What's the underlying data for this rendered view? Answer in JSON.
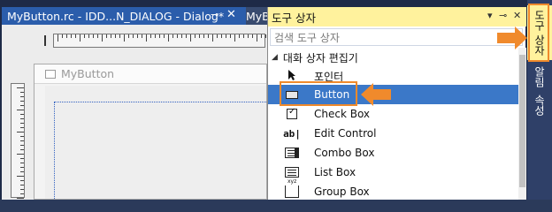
{
  "editor": {
    "active_tab": "MyButton.rc - IDD...N_DIALOG - Dialog*",
    "inactive_tab": "MyB",
    "dialog_title": "MyButton"
  },
  "toolbox": {
    "title": "도구 상자",
    "search_placeholder": "검색 도구 상자",
    "group": "대화 상자 편집기",
    "items": [
      {
        "label": "포인터",
        "icon": "pointer-icon"
      },
      {
        "label": "Button",
        "icon": "button-icon",
        "selected": true
      },
      {
        "label": "Check Box",
        "icon": "checkbox-icon"
      },
      {
        "label": "Edit Control",
        "icon": "edit-control-icon"
      },
      {
        "label": "Combo Box",
        "icon": "combo-box-icon"
      },
      {
        "label": "List Box",
        "icon": "list-box-icon"
      },
      {
        "label": "Group Box",
        "icon": "group-box-icon"
      }
    ]
  },
  "side_tabs": [
    {
      "label": "도구 상자",
      "active": true
    },
    {
      "label": "알림"
    },
    {
      "label": "속성"
    }
  ],
  "colors": {
    "accent_highlight": "#f08a2c",
    "selection": "#3b78c8",
    "toolbox_header": "#fff29d"
  }
}
